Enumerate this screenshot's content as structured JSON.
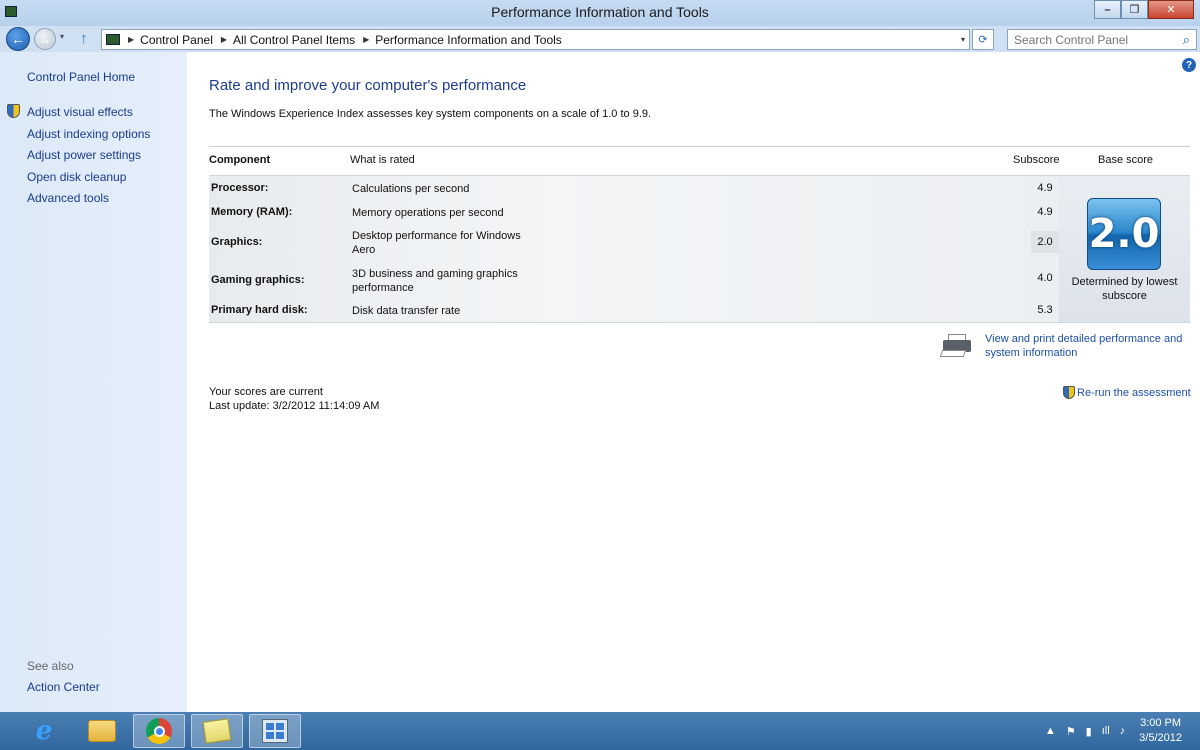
{
  "window": {
    "title": "Performance Information and Tools",
    "minimize_label": "–",
    "maximize_label": "❐",
    "close_label": "✕"
  },
  "navbar": {
    "back_label": "←",
    "forward_label": "→",
    "history_label": "▾",
    "up_label": "↑",
    "breadcrumbs": [
      "Control Panel",
      "All Control Panel Items",
      "Performance Information and Tools"
    ],
    "crumb_separator": "▶",
    "dropdown_label": "▾",
    "refresh_label": "⟳",
    "search_placeholder": "Search Control Panel",
    "search_glyph": "⌕"
  },
  "sidebar": {
    "home": "Control Panel Home",
    "links": [
      "Adjust visual effects",
      "Adjust indexing options",
      "Adjust power settings",
      "Open disk cleanup",
      "Advanced tools"
    ],
    "see_also": "See also",
    "action_center": "Action Center"
  },
  "main": {
    "help_label": "?",
    "title": "Rate and improve your computer's performance",
    "intro": "The Windows Experience Index assesses key system components on a scale of 1.0 to 9.9.",
    "headers": {
      "component": "Component",
      "what": "What is rated",
      "subscore": "Subscore",
      "base": "Base score"
    },
    "rows": [
      {
        "component": "Processor:",
        "what": "Calculations per second",
        "subscore": "4.9"
      },
      {
        "component": "Memory (RAM):",
        "what": "Memory operations per second",
        "subscore": "4.9"
      },
      {
        "component": "Graphics:",
        "what": "Desktop performance for Windows Aero",
        "subscore": "2.0"
      },
      {
        "component": "Gaming graphics:",
        "what": "3D business and gaming graphics performance",
        "subscore": "4.0"
      },
      {
        "component": "Primary hard disk:",
        "what": "Disk data transfer rate",
        "subscore": "5.3"
      }
    ],
    "base_score": "2.0",
    "base_caption": "Determined by lowest subscore",
    "print_link": "View and print detailed performance and system information",
    "status_current": "Your scores are current",
    "last_update": "Last update: 3/2/2012 11:14:09 AM",
    "rerun": "Re-run the assessment"
  },
  "taskbar": {
    "ie_glyph": "e",
    "tray_arrow": "▲",
    "tray_flag": "⚑",
    "tray_power": "▮",
    "tray_signal": "ıll",
    "tray_volume": "♪",
    "time": "3:00 PM",
    "date": "3/5/2012"
  }
}
